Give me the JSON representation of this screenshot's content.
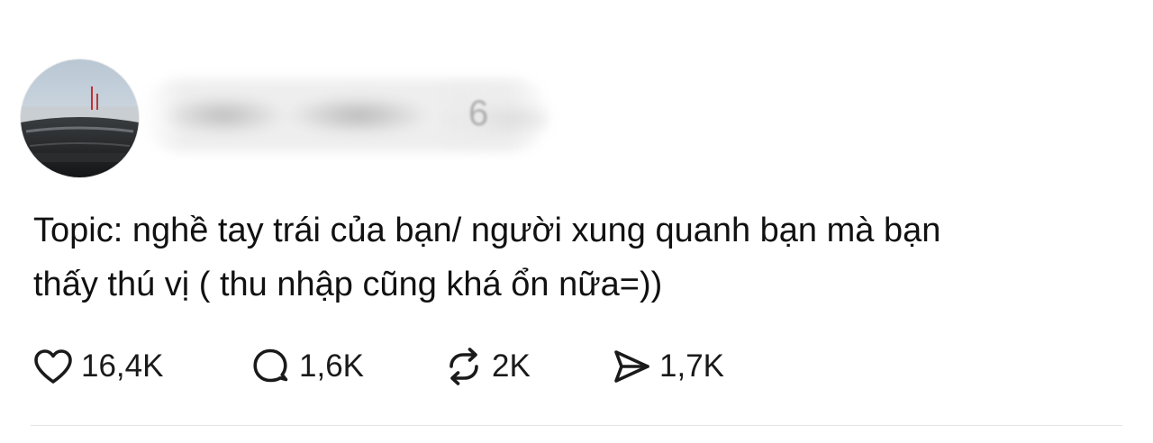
{
  "post": {
    "username": "",
    "timestamp": "6",
    "text_line1": "Topic: nghề tay trái của bạn/ người xung quanh bạn mà bạn",
    "text_line2": "thấy thú vị ( thu nhập cũng khá ổn nữa=))"
  },
  "actions": {
    "likes": {
      "icon": "heart-icon",
      "count": "16,4K"
    },
    "replies": {
      "icon": "speech-bubble-icon",
      "count": "1,6K"
    },
    "reposts": {
      "icon": "repost-icon",
      "count": "2K"
    },
    "shares": {
      "icon": "send-icon",
      "count": "1,7K"
    }
  },
  "colors": {
    "text": "#111111",
    "muted": "#9a9a9a",
    "divider": "#e4e4e4"
  }
}
